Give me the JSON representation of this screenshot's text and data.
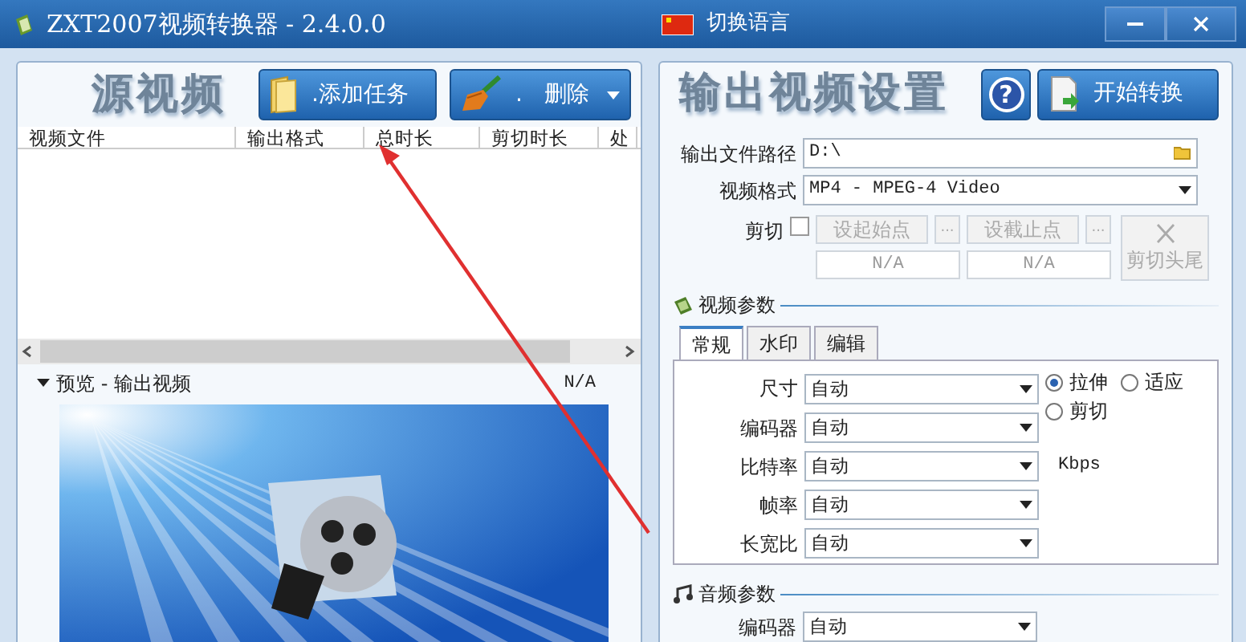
{
  "window": {
    "title": "ZXT2007视频转换器 - 2.4.0.0",
    "language_button": "切换语言"
  },
  "source": {
    "title": "源视频",
    "buttons": [
      {
        "kind": "add",
        "label": ".添加任务",
        "dropdown": false
      },
      {
        "kind": "delete",
        "label": ".   删除",
        "dropdown": true
      }
    ],
    "columns": [
      "视频文件",
      "输出格式",
      "总时长",
      "剪切时长",
      "处"
    ],
    "preview": {
      "title": "预览 - 输出视频",
      "expanded": true,
      "info": "N/A"
    }
  },
  "output": {
    "title": "输出视频设置",
    "help_button": "?",
    "start_button": "开始转换",
    "path": {
      "label": "输出文件路径",
      "value": "D:\\"
    },
    "format": {
      "label": "视频格式",
      "value": "MP4 - MPEG-4 Video"
    },
    "cut": {
      "label": "剪切",
      "checked": false,
      "disabled": true,
      "start_button": "设起始点",
      "start_more": "...",
      "end_button": "设截止点",
      "end_more": "...",
      "start_value": "N/A",
      "end_value": "N/A",
      "trim_button": "剪切头尾"
    },
    "video": {
      "title": "视频参数",
      "tabs": [
        {
          "label": "常规",
          "selected": true
        },
        {
          "label": "水印",
          "selected": false
        },
        {
          "label": "编辑",
          "selected": false
        }
      ],
      "fields": [
        {
          "label": "尺寸",
          "value": "自动"
        },
        {
          "label": "编码器",
          "value": "自动"
        },
        {
          "label": "比特率",
          "value": "自动",
          "unit": "Kbps"
        },
        {
          "label": "帧率",
          "value": "自动"
        },
        {
          "label": "长宽比",
          "value": "自动"
        }
      ],
      "resize_modes": [
        {
          "label": "拉伸",
          "selected": true
        },
        {
          "label": "适应",
          "selected": false
        },
        {
          "label": "剪切",
          "selected": false
        }
      ]
    },
    "audio": {
      "title": "音频参数",
      "fields": [
        {
          "label": "编码器",
          "value": "自动"
        }
      ]
    }
  }
}
